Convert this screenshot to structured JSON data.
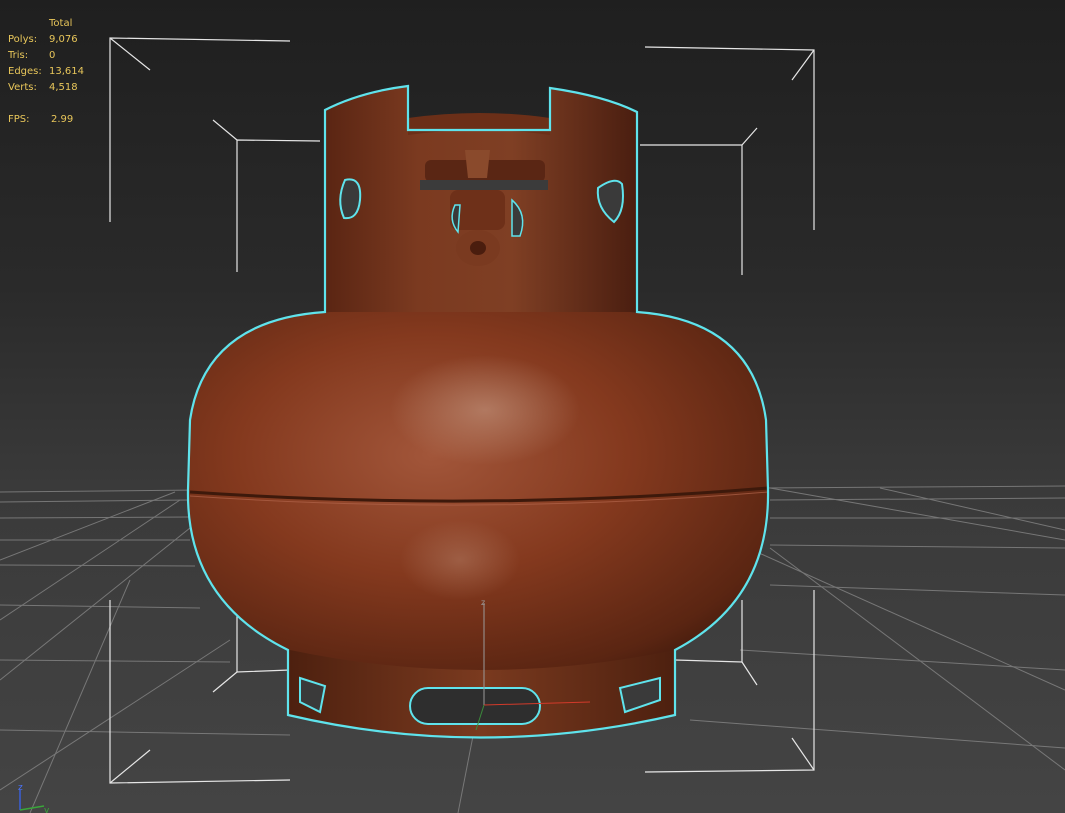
{
  "stats": {
    "header": "Total",
    "rows": [
      {
        "label": "Polys:",
        "value": "9,076"
      },
      {
        "label": "Tris:",
        "value": "0"
      },
      {
        "label": "Edges:",
        "value": "13,614"
      },
      {
        "label": "Verts:",
        "value": "4,518"
      }
    ],
    "fps": {
      "label": "FPS:",
      "value": "2.99"
    }
  },
  "axis_gizmo": {
    "z_label": "z",
    "y_label": "y"
  },
  "colors": {
    "stats_text": "#e8c65a",
    "selection_outline": "#5fe3ec",
    "bounding_box": "#e6e6e6",
    "grid": "#8a8a8a",
    "object_base": "#7a3318"
  },
  "object": {
    "name_icon": "gas-cylinder-model"
  }
}
